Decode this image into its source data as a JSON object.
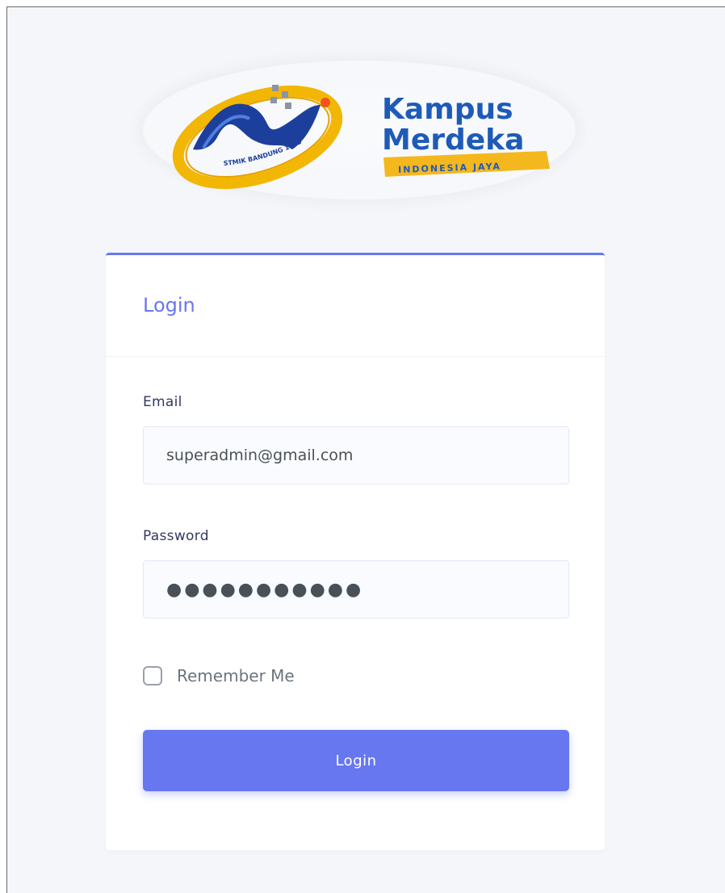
{
  "logos": {
    "stmik": {
      "icon": "stmik-bandung-logo",
      "seal_text": "STMIK BANDUNG 1993",
      "colors": {
        "ring": "#f2b705",
        "swoosh": "#1d3f9c",
        "dot": "#f0541e"
      }
    },
    "kampus_merdeka": {
      "icon": "kampus-merdeka-logo",
      "line1": "Kampus",
      "line2": "Merdeka",
      "ribbon": "INDONESIA JAYA",
      "colors": {
        "text": "#1e5bb8",
        "ribbon": "#f5b71e"
      }
    }
  },
  "login_card": {
    "title": "Login",
    "email": {
      "label": "Email",
      "value": "superadmin@gmail.com"
    },
    "password": {
      "label": "Password",
      "masked_value": "●●●●●●●●●●●"
    },
    "remember": {
      "label": "Remember Me",
      "checked": false
    },
    "submit_label": "Login"
  },
  "colors": {
    "accent": "#6777ef",
    "page_bg": "#f4f6f9",
    "card_bg": "#ffffff"
  }
}
